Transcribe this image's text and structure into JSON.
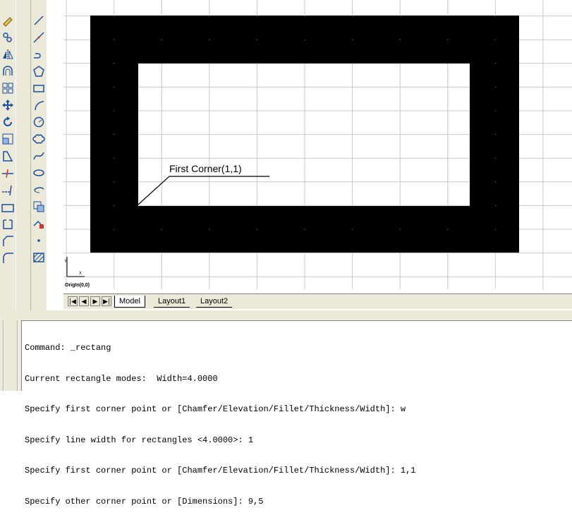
{
  "canvas": {
    "annotation_label": "First Corner(1,1)",
    "ucs_label": "OrigIn(0,0)"
  },
  "tabs": {
    "model": "Model",
    "layout1": "Layout1",
    "layout2": "Layout2"
  },
  "nav": [
    "|◀",
    "◀",
    "▶",
    "▶|"
  ],
  "command_line": {
    "lines": [
      "Command: _rectang",
      "Current rectangle modes:  Width=4.0000",
      "Specify first corner point or [Chamfer/Elevation/Fillet/Thickness/Width]: w",
      "Specify line width for rectangles <4.0000>: 1",
      "Specify first corner point or [Chamfer/Elevation/Fillet/Thickness/Width]: 1,1",
      "Specify other corner point or [Dimensions]: 9,5"
    ]
  },
  "icons": {
    "modify": [
      "erase-icon",
      "copy-icon",
      "mirror-icon",
      "offset-icon",
      "array-icon",
      "move-icon",
      "rotate-icon",
      "scale-icon",
      "stretch-icon",
      "trim-icon",
      "extend-icon",
      "break-icon",
      "join-icon",
      "chamfer-icon",
      "fillet-icon"
    ],
    "draw": [
      "line-icon",
      "construction-line-icon",
      "polyline-icon",
      "polygon-icon",
      "rectangle-icon",
      "arc-icon",
      "circle-icon",
      "revision-cloud-icon",
      "spline-icon",
      "ellipse-icon",
      "ellipse-arc-icon",
      "insert-block-icon",
      "make-block-icon",
      "point-icon",
      "hatch-icon"
    ]
  }
}
